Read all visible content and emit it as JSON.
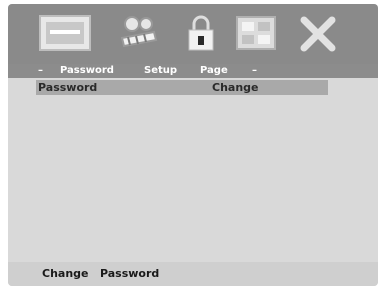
{
  "toolbar": {
    "icons": [
      "language-icon",
      "video-icon",
      "lock-icon",
      "grid-icon",
      "close-icon"
    ],
    "active": "lock-icon"
  },
  "tabs": {
    "left_marker": "–",
    "password": "Password",
    "setup": "Setup",
    "page": "Page",
    "right_marker": "–"
  },
  "row": {
    "label": "Password",
    "value": "Change"
  },
  "status": {
    "text": "Change   Password"
  },
  "colors": {
    "toolbar": "#8a8a8a",
    "selection": "#a9a9a9",
    "background": "#d9d9d9"
  }
}
